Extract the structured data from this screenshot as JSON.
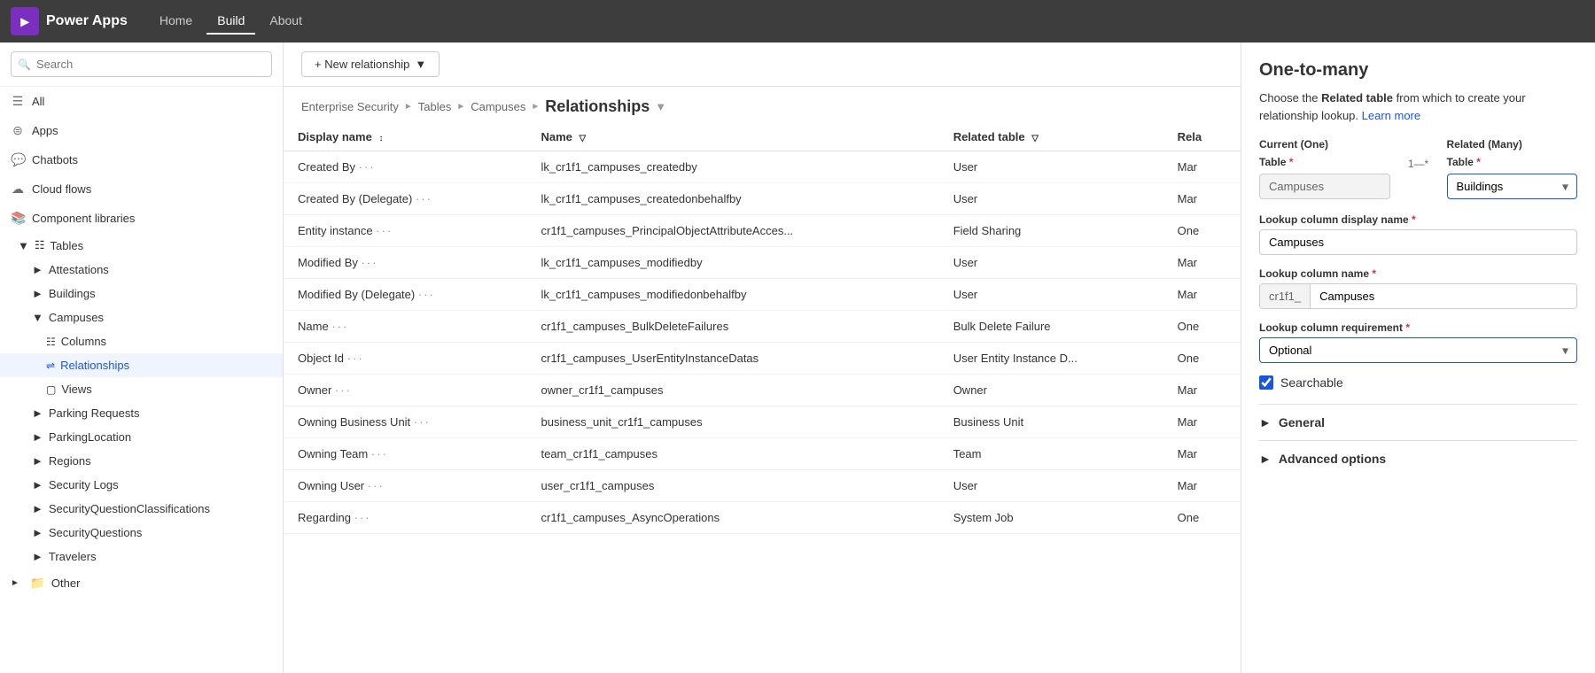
{
  "topNav": {
    "logoText": "Power Apps",
    "links": [
      {
        "label": "Home",
        "active": false
      },
      {
        "label": "Build",
        "active": true
      },
      {
        "label": "About",
        "active": false
      }
    ]
  },
  "sidebar": {
    "searchPlaceholder": "Search",
    "items": [
      {
        "label": "All",
        "icon": "☰",
        "level": "top"
      },
      {
        "label": "Apps",
        "icon": "⊞",
        "level": "top"
      },
      {
        "label": "Chatbots",
        "icon": "💬",
        "level": "top"
      },
      {
        "label": "Cloud flows",
        "icon": "☁",
        "level": "top"
      },
      {
        "label": "Component libraries",
        "icon": "📚",
        "level": "top"
      },
      {
        "label": "Tables",
        "icon": "⊞",
        "level": "top",
        "expanded": true
      }
    ],
    "tables": [
      {
        "label": "Attestations",
        "expanded": false
      },
      {
        "label": "Buildings",
        "expanded": false
      },
      {
        "label": "Campuses",
        "expanded": true,
        "children": [
          {
            "label": "Columns"
          },
          {
            "label": "Relationships",
            "active": true
          },
          {
            "label": "Views"
          }
        ]
      },
      {
        "label": "Parking Requests",
        "expanded": false
      },
      {
        "label": "ParkingLocation",
        "expanded": false
      },
      {
        "label": "Regions",
        "expanded": false
      },
      {
        "label": "Security Logs",
        "expanded": false
      },
      {
        "label": "SecurityQuestionClassifications",
        "expanded": false
      },
      {
        "label": "SecurityQuestions",
        "expanded": false
      },
      {
        "label": "Travelers",
        "expanded": false
      }
    ],
    "other": {
      "label": "Other",
      "icon": "📁"
    }
  },
  "toolbar": {
    "newRelationshipLabel": "+ New relationship"
  },
  "breadcrumb": {
    "items": [
      "Enterprise Security",
      "Tables",
      "Campuses"
    ],
    "current": "Relationships"
  },
  "table": {
    "columns": [
      "Display name",
      "Name",
      "Related table",
      "Rela"
    ],
    "rows": [
      {
        "displayName": "Created By",
        "dots": "···",
        "name": "lk_cr1f1_campuses_createdby",
        "relatedTable": "User",
        "relType": "Mar"
      },
      {
        "displayName": "Created By (Delegate)",
        "dots": "···",
        "name": "lk_cr1f1_campuses_createdonbehalfby",
        "relatedTable": "User",
        "relType": "Mar"
      },
      {
        "displayName": "Entity instance",
        "dots": "···",
        "name": "cr1f1_campuses_PrincipalObjectAttributeAcces...",
        "relatedTable": "Field Sharing",
        "relType": "One"
      },
      {
        "displayName": "Modified By",
        "dots": "···",
        "name": "lk_cr1f1_campuses_modifiedby",
        "relatedTable": "User",
        "relType": "Mar"
      },
      {
        "displayName": "Modified By (Delegate)",
        "dots": "···",
        "name": "lk_cr1f1_campuses_modifiedonbehalfby",
        "relatedTable": "User",
        "relType": "Mar"
      },
      {
        "displayName": "Name",
        "dots": "···",
        "name": "cr1f1_campuses_BulkDeleteFailures",
        "relatedTable": "Bulk Delete Failure",
        "relType": "One"
      },
      {
        "displayName": "Object Id",
        "dots": "···",
        "name": "cr1f1_campuses_UserEntityInstanceDatas",
        "relatedTable": "User Entity Instance D...",
        "relType": "One"
      },
      {
        "displayName": "Owner",
        "dots": "···",
        "name": "owner_cr1f1_campuses",
        "relatedTable": "Owner",
        "relType": "Mar"
      },
      {
        "displayName": "Owning Business Unit",
        "dots": "···",
        "name": "business_unit_cr1f1_campuses",
        "relatedTable": "Business Unit",
        "relType": "Mar"
      },
      {
        "displayName": "Owning Team",
        "dots": "···",
        "name": "team_cr1f1_campuses",
        "relatedTable": "Team",
        "relType": "Mar"
      },
      {
        "displayName": "Owning User",
        "dots": "···",
        "name": "user_cr1f1_campuses",
        "relatedTable": "User",
        "relType": "Mar"
      },
      {
        "displayName": "Regarding",
        "dots": "···",
        "name": "cr1f1_campuses_AsyncOperations",
        "relatedTable": "System Job",
        "relType": "One"
      }
    ]
  },
  "panel": {
    "title": "One-to-many",
    "description": "Choose the ",
    "descBold": "Related table",
    "descAfter": " from which to create your relationship lookup.",
    "learnMore": "Learn more",
    "currentLabel": "Current (One)",
    "relatedLabel": "Related (Many)",
    "tableLabel": "Table",
    "currentTable": "Campuses",
    "connectorLeft": "1",
    "connectorRight": "*",
    "relatedTableLabel": "Table",
    "relatedTableValue": "Buildings",
    "lookupDisplayLabel": "Lookup column display name",
    "lookupDisplayValue": "Campuses",
    "lookupNameLabel": "Lookup column name",
    "lookupNamePrefix": "cr1f1_",
    "lookupNameValue": "Campuses",
    "lookupReqLabel": "Lookup column requirement",
    "lookupReqValue": "Optional",
    "searchableLabel": "Searchable",
    "searchableChecked": true,
    "generalLabel": "General",
    "advancedLabel": "Advanced options"
  }
}
